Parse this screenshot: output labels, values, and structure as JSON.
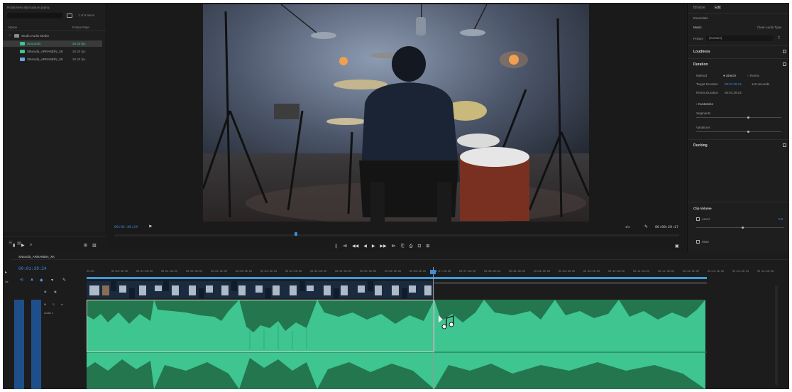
{
  "project": {
    "path": "Rolds/Velocidly/capture.prproj",
    "count": "1 of 6 items",
    "col_name": "Name",
    "col_rate": "Frame Rate",
    "items": [
      {
        "name": "Studio Audio Media",
        "rate": "",
        "icon": "folder-icon",
        "selected": false
      },
      {
        "name": "dvsounds",
        "rate": "30.00 fps",
        "icon": "sequence-icon",
        "selected": true
      },
      {
        "name": "SNsnufa_ARRAMDN_XK",
        "rate": "30.00 fps",
        "icon": "audio-clip-icon",
        "selected": false
      },
      {
        "name": "SNsnufa_ARRAMDN_XK",
        "rate": "30.00 fps",
        "icon": "video-clip-icon",
        "selected": false
      }
    ]
  },
  "viewer": {
    "timecode_left": "00:01:39:24",
    "timecode_right": "00:08:29:17",
    "fit": "1/4",
    "transport": [
      "❙",
      "⧏",
      "◀◀",
      "◀",
      "▶",
      "▶▶",
      "⧐",
      "⎘",
      "⎙",
      "⊡",
      "⊞"
    ]
  },
  "essential_sound": {
    "tabs": [
      "Browse",
      "Edit"
    ],
    "active_tab": "Edit",
    "clip": "Essentials",
    "type_label": "Music",
    "clear": "Clear Audio Type",
    "preset_label": "Preset",
    "preset_value": "(Custom)",
    "loudness": "Loudness",
    "duration": "Duration",
    "method_label": "Method",
    "method_stretch": "Stretch",
    "method_remix": "Remix",
    "target_label": "Target Duration",
    "target_value": "00:01:39:24",
    "target_extra": "1s0 seconds",
    "remix_label": "Remix Duration",
    "remix_value": "00:01:39:24",
    "customize": "Customize",
    "segments": "Segments",
    "variations": "Variations",
    "ducking": "Ducking",
    "clip_volume": "Clip Volume",
    "level": "Level",
    "level_value": "0.0",
    "mute": "Mute"
  },
  "timeline": {
    "sequence_name": "SNsnufa_ARRAMDN_XK",
    "timecode": "00:01:39:24",
    "ruler": [
      "00:00",
      "00:00:30:00",
      "00:01:00:00",
      "00:01:30:00",
      "00:02:00:00",
      "00:02:30:00",
      "00:03:00:00",
      "00:03:30:00",
      "00:04:00:00",
      "00:04:30:00",
      "00:05:00:00",
      "00:05:30:00",
      "00:06:00:00",
      "00:06:30:00",
      "00:07:00:00",
      "00:07:30:00",
      "00:08:00:00",
      "00:08:30:00",
      "00:09:00:00",
      "00:09:30:00",
      "00:10:00:00",
      "00:10:30:00",
      "00:11:00:00",
      "00:11:30:00",
      "00:12:00:00",
      "00:12:30:00",
      "00:13:00:00",
      "00:13:30:00"
    ]
  },
  "colors": {
    "accent": "#3e8ee0",
    "audio_clip": "#3ec590",
    "audio_wave": "#24764f"
  }
}
